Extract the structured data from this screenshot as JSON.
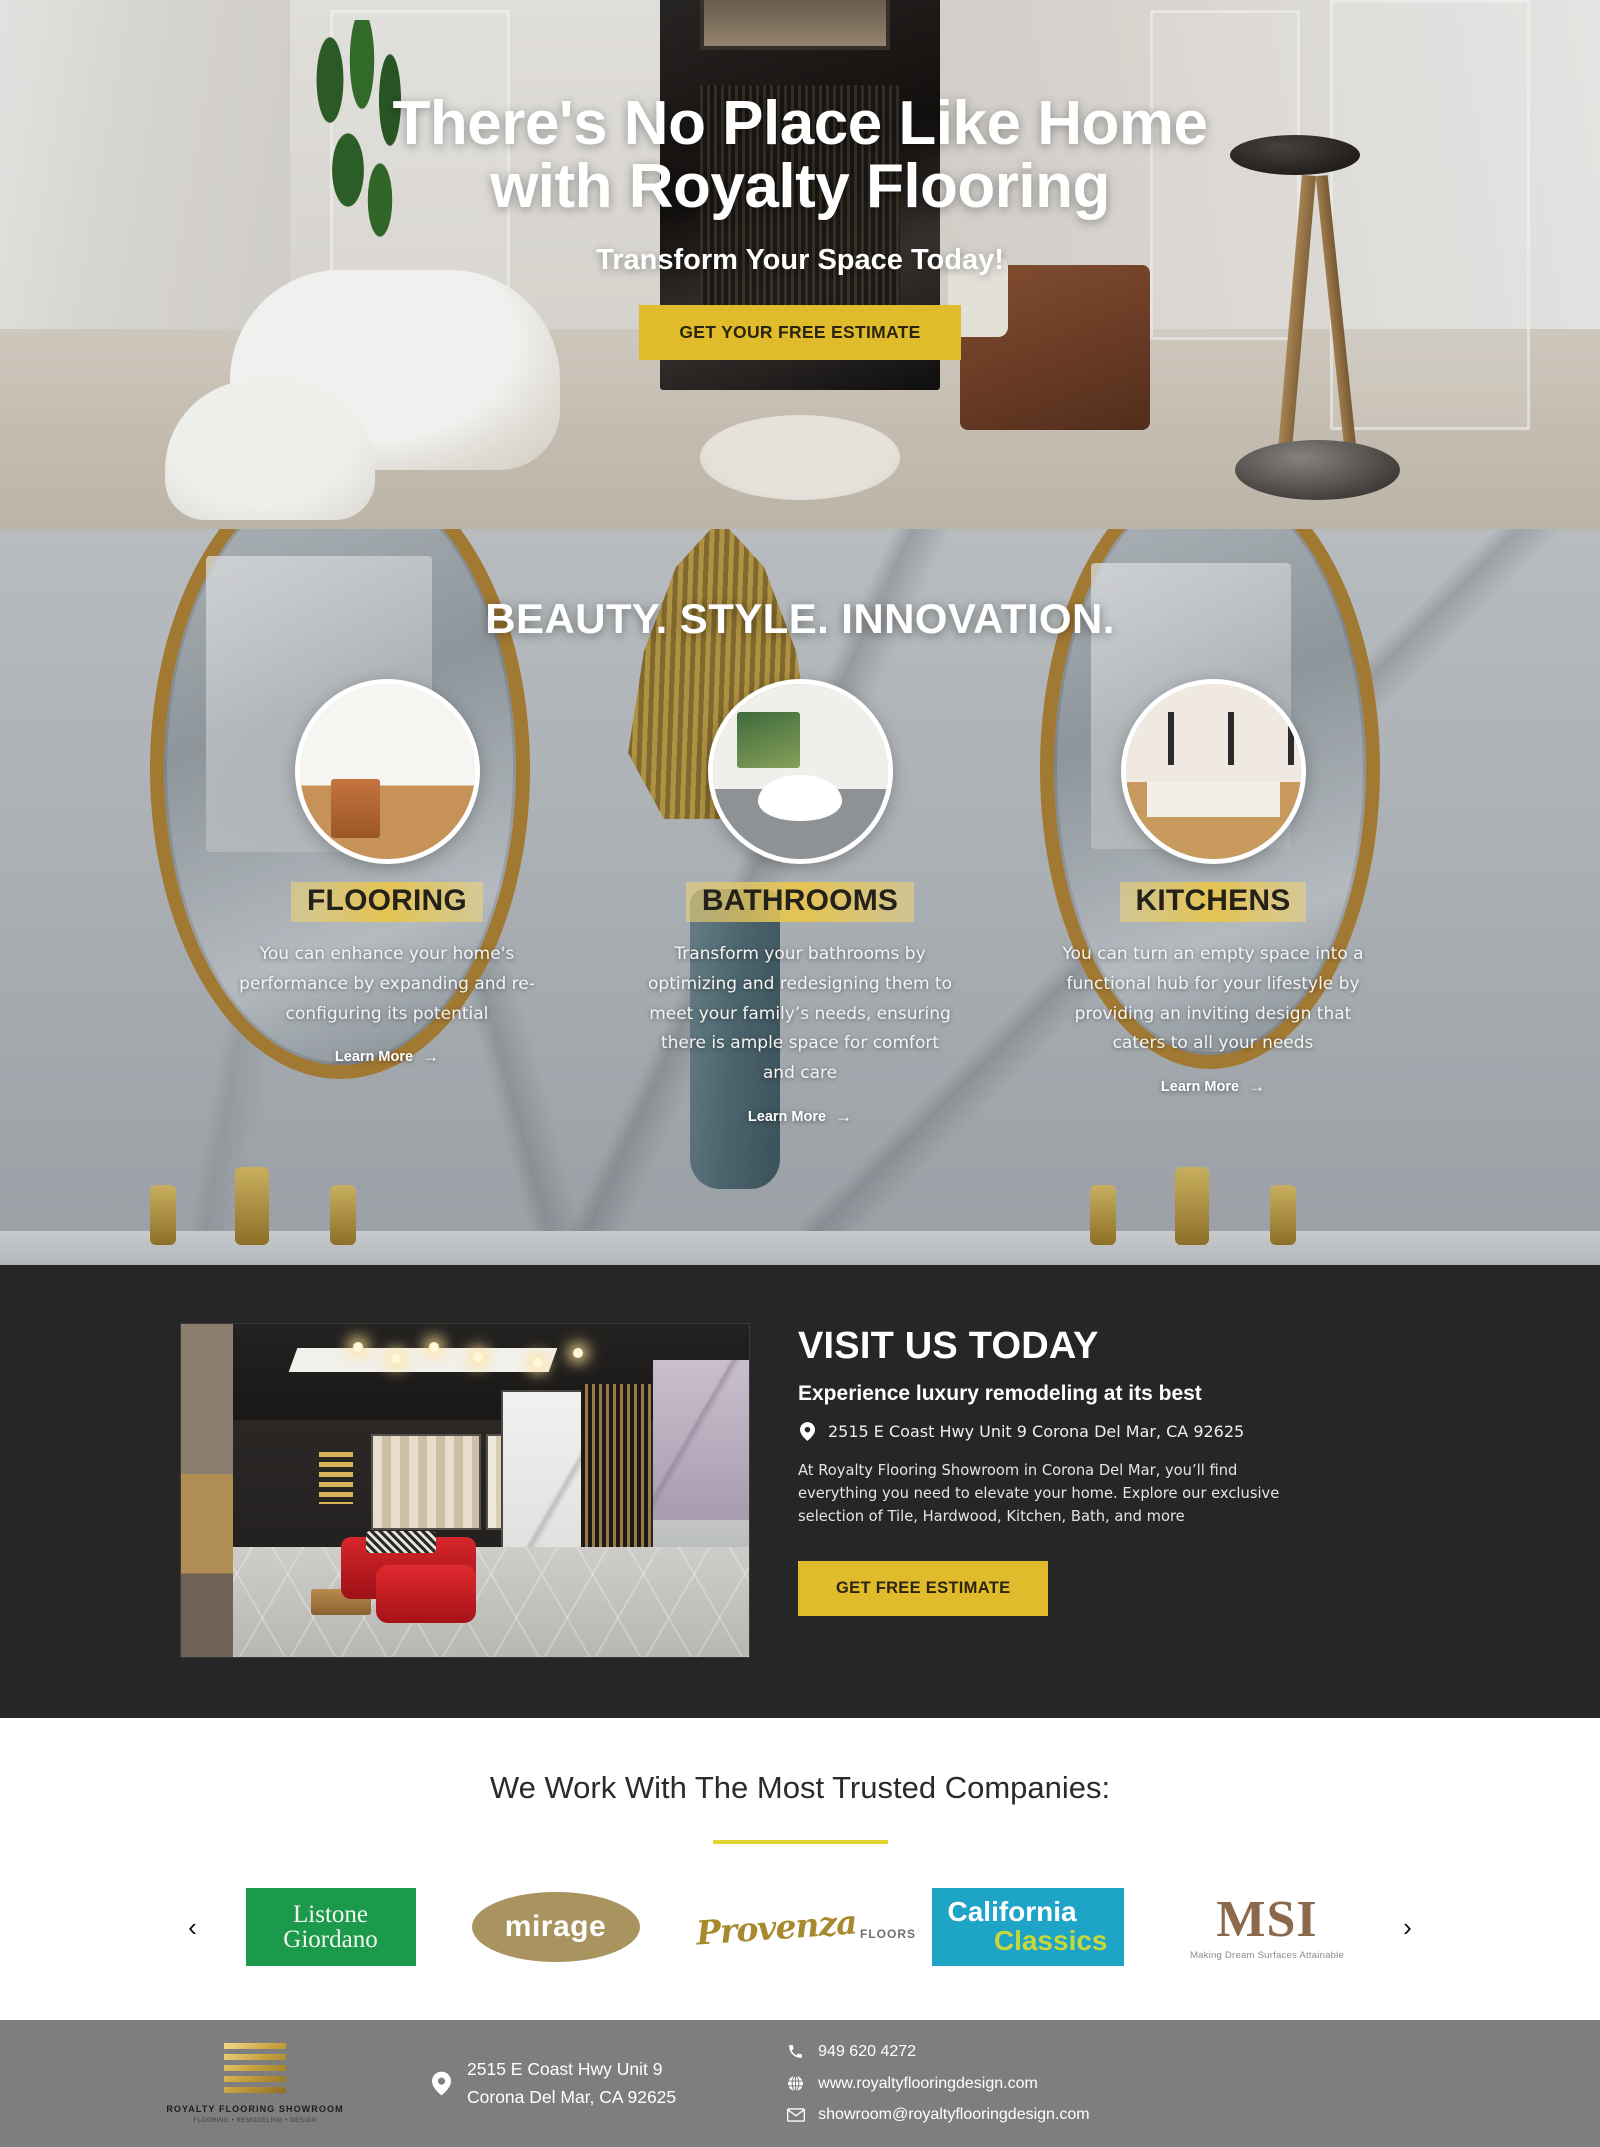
{
  "hero": {
    "title_line1": "There's No Place Like Home",
    "title_line2": "with Royalty Flooring",
    "subtitle": "Transform Your Space Today!",
    "cta_label": "GET YOUR FREE ESTIMATE"
  },
  "services": {
    "heading": "BEAUTY. STYLE. INNOVATION.",
    "learn_more_label": "Learn More",
    "arrow_glyph": "→",
    "cards": [
      {
        "title": "FLOORING",
        "text": "You can enhance your home's performance by expanding and re-configuring its potential",
        "image_name": "flooring-interior-photo"
      },
      {
        "title": "BATHROOMS",
        "text": "Transform your bathrooms by optimizing and redesigning them to meet your family’s needs, ensuring there is ample space for comfort and care",
        "image_name": "bathroom-interior-photo"
      },
      {
        "title": "KITCHENS",
        "text": "You can turn an empty space into a functional hub for your lifestyle by providing an inviting design that caters to all your needs",
        "image_name": "kitchen-interior-photo"
      }
    ]
  },
  "visit": {
    "heading": "VISIT US TODAY",
    "subheading": "Experience luxury remodeling at its best",
    "address": "2515 E Coast Hwy Unit 9 Corona Del Mar, CA 92625",
    "body": "At Royalty Flooring Showroom in Corona Del Mar, you’ll find everything you need to elevate your home. Explore our exclusive selection of Tile, Hardwood, Kitchen, Bath, and more",
    "cta_label": "GET FREE ESTIMATE",
    "image_name": "showroom-photo"
  },
  "partners": {
    "heading": "We Work With The Most Trusted Companies:",
    "prev_glyph": "‹",
    "next_glyph": "›",
    "logos": [
      {
        "name": "listone-giordano",
        "line1": "Listone",
        "line2": "Giordano"
      },
      {
        "name": "mirage",
        "line1": "mirage"
      },
      {
        "name": "provenza-floors",
        "line1": "Provenza",
        "line2": "FLOORS"
      },
      {
        "name": "california-classics",
        "line1": "California",
        "line2": "Classics"
      },
      {
        "name": "msi",
        "line1": "MSI",
        "line2": "Making Dream Surfaces Attainable"
      }
    ]
  },
  "footer": {
    "logo_name": "ROYALTY FLOORING SHOWROOM",
    "logo_tagline": "FLOORING • REMODELING • DESIGN",
    "address_line1": "2515 E Coast Hwy Unit 9",
    "address_line2": "Corona Del Mar, CA 92625",
    "phone": "949 620 4272",
    "website": "www.royaltyflooringdesign.com",
    "email": "showroom@royaltyflooringdesign.com"
  },
  "colors": {
    "gold": "#E0BC2C",
    "dark_section": "#262626",
    "footer_gray": "#7E7E7E",
    "rule_yellow": "#E2D32F",
    "listone_green": "#1C9A4B",
    "mirage_gold": "#A9945F",
    "provenza_gold": "#A78A2E",
    "california_teal": "#1EA4C6",
    "california_lime": "#C6D93B",
    "msi_brown": "#8A6A4A"
  }
}
